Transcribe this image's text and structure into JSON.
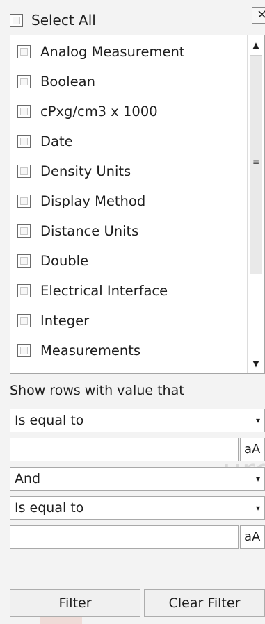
{
  "select_all": {
    "label": "Select All",
    "checked": false
  },
  "close_icon_glyph": "×",
  "items": [
    {
      "label": "Analog Measurement",
      "checked": false
    },
    {
      "label": "Boolean",
      "checked": false
    },
    {
      "label": "cPxg/cm3 x 1000",
      "checked": false
    },
    {
      "label": "Date",
      "checked": false
    },
    {
      "label": "Density Units",
      "checked": false
    },
    {
      "label": "Display Method",
      "checked": false
    },
    {
      "label": "Distance Units",
      "checked": false
    },
    {
      "label": "Double",
      "checked": false
    },
    {
      "label": "Electrical Interface",
      "checked": false
    },
    {
      "label": "Integer",
      "checked": false
    },
    {
      "label": "Measurements",
      "checked": false
    }
  ],
  "scrollbar": {
    "up_glyph": "▲",
    "down_glyph": "▼",
    "grip_glyph": "≡"
  },
  "filter": {
    "label": "Show rows with value that",
    "condition1": "Is equal to",
    "value1": "",
    "operator": "And",
    "condition2": "Is equal to",
    "value2": "",
    "case_label": "aA",
    "dropdown_glyph": "▾"
  },
  "buttons": {
    "filter": "Filter",
    "clear": "Clear Filter"
  }
}
